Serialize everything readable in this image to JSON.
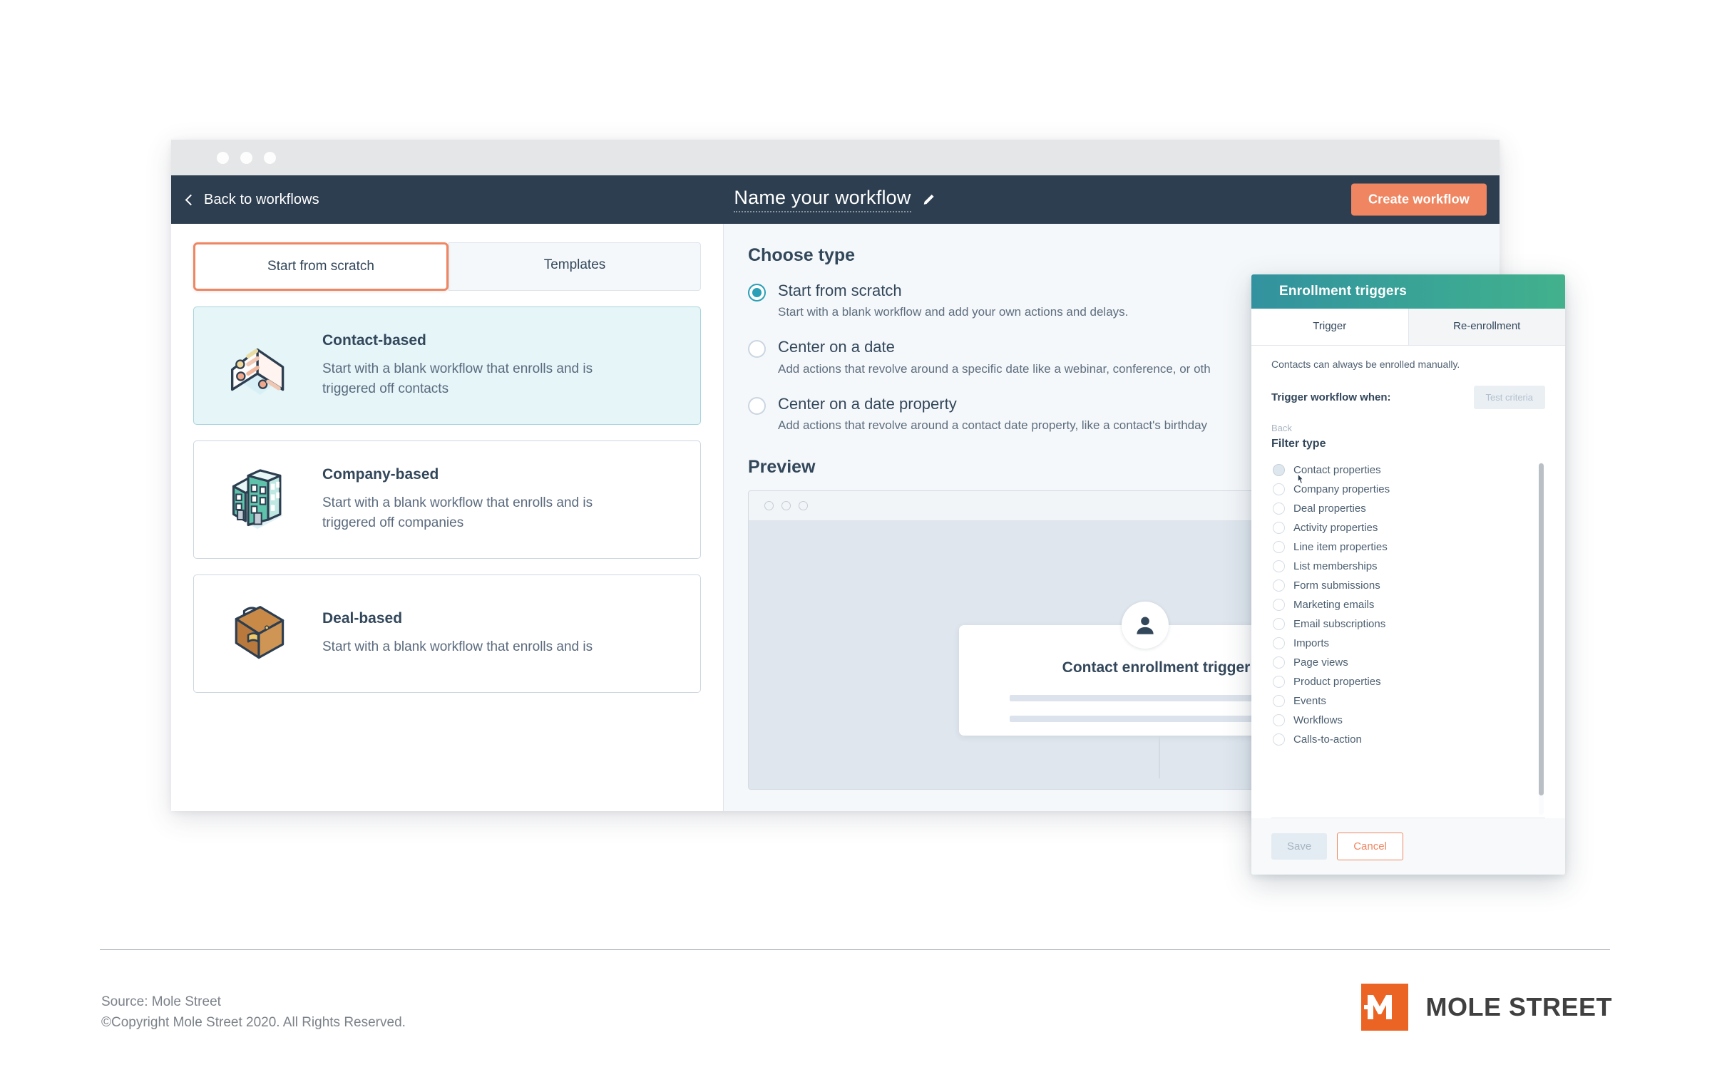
{
  "browser": {
    "chrome_dots": 3
  },
  "app_header": {
    "back_label": "Back to workflows",
    "back_icon": "chevron-left-icon",
    "workflow_title": "Name your workflow",
    "edit_icon": "pencil-icon",
    "create_button": "Create workflow",
    "accent_orange": "#ef8661",
    "header_bg": "#2d3e50"
  },
  "left_pane": {
    "tabs": [
      {
        "label": "Start from scratch",
        "active": true
      },
      {
        "label": "Templates",
        "active": false
      }
    ],
    "cards": [
      {
        "title": "Contact-based",
        "description": "Start with a blank workflow that enrolls and is triggered off contacts",
        "icon": "contact-list-icon",
        "selected": true
      },
      {
        "title": "Company-based",
        "description": "Start with a blank workflow that enrolls and is triggered off companies",
        "icon": "office-building-icon",
        "selected": false
      },
      {
        "title": "Deal-based",
        "description": "Start with a blank workflow that enrolls and is",
        "icon": "briefcase-icon",
        "selected": false
      }
    ]
  },
  "main": {
    "choose_type_title": "Choose type",
    "options": [
      {
        "label": "Start from scratch",
        "description": "Start with a blank workflow and add your own actions and delays.",
        "checked": true
      },
      {
        "label": "Center on a date",
        "description": "Add actions that revolve around a specific date like a webinar, conference, or oth",
        "checked": false
      },
      {
        "label": "Center on a date property",
        "description": "Add actions that revolve around a contact date property, like a contact's birthday",
        "checked": false
      }
    ],
    "preview_title": "Preview",
    "preview": {
      "card_title": "Contact enrollment trigger:",
      "avatar_icon": "person-avatar-icon",
      "dots": 3
    }
  },
  "panel": {
    "title": "Enrollment triggers",
    "header_gradient_from": "#33929f",
    "header_gradient_to": "#42b18c",
    "tabs": [
      {
        "label": "Trigger",
        "active": true
      },
      {
        "label": "Re-enrollment",
        "active": false
      }
    ],
    "note": "Contacts can always be enrolled manually.",
    "trigger_when_label": "Trigger workflow when:",
    "test_criteria_button": "Test criteria",
    "back_label": "Back",
    "filter_type_heading": "Filter type",
    "filter_items": [
      {
        "label": "Contact properties",
        "hovered": true
      },
      {
        "label": "Company properties",
        "hovered": false
      },
      {
        "label": "Deal properties",
        "hovered": false
      },
      {
        "label": "Activity properties",
        "hovered": false
      },
      {
        "label": "Line item properties",
        "hovered": false
      },
      {
        "label": "List memberships",
        "hovered": false
      },
      {
        "label": "Form submissions",
        "hovered": false
      },
      {
        "label": "Marketing emails",
        "hovered": false
      },
      {
        "label": "Email subscriptions",
        "hovered": false
      },
      {
        "label": "Imports",
        "hovered": false
      },
      {
        "label": "Page views",
        "hovered": false
      },
      {
        "label": "Product properties",
        "hovered": false
      },
      {
        "label": "Events",
        "hovered": false
      },
      {
        "label": "Workflows",
        "hovered": false
      },
      {
        "label": "Calls-to-action",
        "hovered": false
      }
    ],
    "save_button": "Save",
    "cancel_button": "Cancel"
  },
  "footer": {
    "source_line": "Source: Mole Street",
    "copyright_line": "©Copyright Mole Street 2020. All Rights Reserved.",
    "logo_word": "MOLE STREET",
    "logo_color": "#eb6424"
  }
}
